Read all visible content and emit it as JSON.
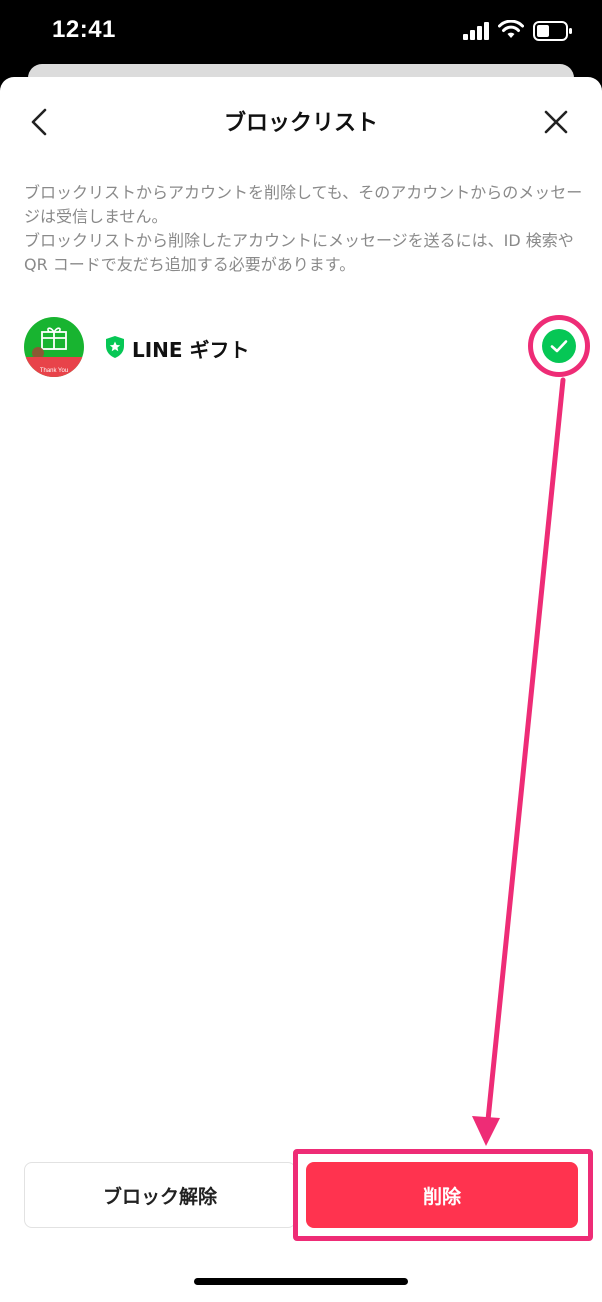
{
  "status_bar": {
    "time": "12:41"
  },
  "header": {
    "title": "ブロックリスト"
  },
  "notice": {
    "line1": "ブロックリストからアカウントを削除しても、そのアカウントからのメッセージは受信しません。",
    "line2": "ブロックリストから削除したアカウントにメッセージを送るには、ID 検索や QR コードで友だち追加する必要があります。"
  },
  "accounts": [
    {
      "name": "LINE ギフト",
      "avatar_text": "Thank You",
      "selected": true
    }
  ],
  "actions": {
    "unblock_label": "ブロック解除",
    "delete_label": "削除"
  },
  "icons": {
    "back": "chevron-left-icon",
    "close": "close-icon",
    "badge": "official-shield-icon",
    "check": "check-icon"
  },
  "colors": {
    "accent_red": "#ff334f",
    "highlight_pink": "#ee2c76",
    "check_green": "#06c755"
  }
}
